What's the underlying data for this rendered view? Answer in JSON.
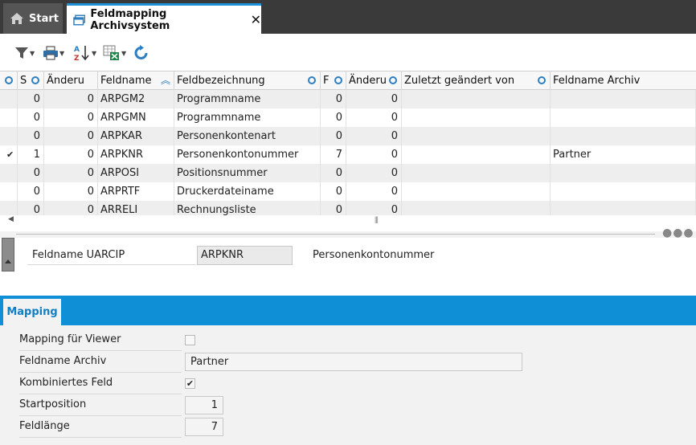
{
  "tabs": {
    "start_label": "Start",
    "active_label": "Feldmapping Archivsystem"
  },
  "grid": {
    "columns": [
      "S",
      "Änderu",
      "Feldname",
      "Feldbezeichnung",
      "F",
      "Änderu",
      "Zuletzt geändert von",
      "Feldname Archiv"
    ],
    "rows": [
      {
        "mark": "",
        "s": "0",
        "aenderu": "0",
        "feldname": "ARPGM2",
        "bez": "Programmname",
        "f": "0",
        "aenderu2": "0",
        "geaendert_von": "",
        "archiv": ""
      },
      {
        "mark": "",
        "s": "0",
        "aenderu": "0",
        "feldname": "ARPGMN",
        "bez": "Programmname",
        "f": "0",
        "aenderu2": "0",
        "geaendert_von": "",
        "archiv": ""
      },
      {
        "mark": "",
        "s": "0",
        "aenderu": "0",
        "feldname": "ARPKAR",
        "bez": "Personenkontenart",
        "f": "0",
        "aenderu2": "0",
        "geaendert_von": "",
        "archiv": ""
      },
      {
        "mark": "✔",
        "s": "1",
        "aenderu": "0",
        "feldname": "ARPKNR",
        "bez": "Personenkontonummer",
        "f": "7",
        "aenderu2": "0",
        "geaendert_von": "",
        "archiv": "Partner"
      },
      {
        "mark": "",
        "s": "0",
        "aenderu": "0",
        "feldname": "ARPOSI",
        "bez": "Positionsnummer",
        "f": "0",
        "aenderu2": "0",
        "geaendert_von": "",
        "archiv": ""
      },
      {
        "mark": "",
        "s": "0",
        "aenderu": "0",
        "feldname": "ARPRTF",
        "bez": "Druckerdateiname",
        "f": "0",
        "aenderu2": "0",
        "geaendert_von": "",
        "archiv": ""
      },
      {
        "mark": "",
        "s": "0",
        "aenderu": "0",
        "feldname": "ARRELI",
        "bez": "Rechnungsliste",
        "f": "0",
        "aenderu2": "0",
        "geaendert_von": "",
        "archiv": ""
      }
    ],
    "scroll_grip": "⦀"
  },
  "detail": {
    "feldname_label": "Feldname UARCIP",
    "feldname_value": "ARPKNR",
    "feldname_desc": "Personenkontonummer"
  },
  "mapping": {
    "tab_label": "Mapping",
    "viewer_label": "Mapping für Viewer",
    "viewer_checked": "",
    "archiv_label": "Feldname Archiv",
    "archiv_value": "Partner",
    "kombiniert_label": "Kombiniertes Feld",
    "kombiniert_checked": "✔",
    "startpos_label": "Startposition",
    "startpos_value": "1",
    "laenge_label": "Feldlänge",
    "laenge_value": "7"
  },
  "icons": [
    "home-icon",
    "window-icon",
    "close-icon",
    "filter-icon",
    "print-icon",
    "sort-az-icon",
    "excel-export-icon",
    "refresh-icon"
  ],
  "colors": {
    "accent": "#0f8fd6",
    "tabbar": "#3a3a3a"
  }
}
